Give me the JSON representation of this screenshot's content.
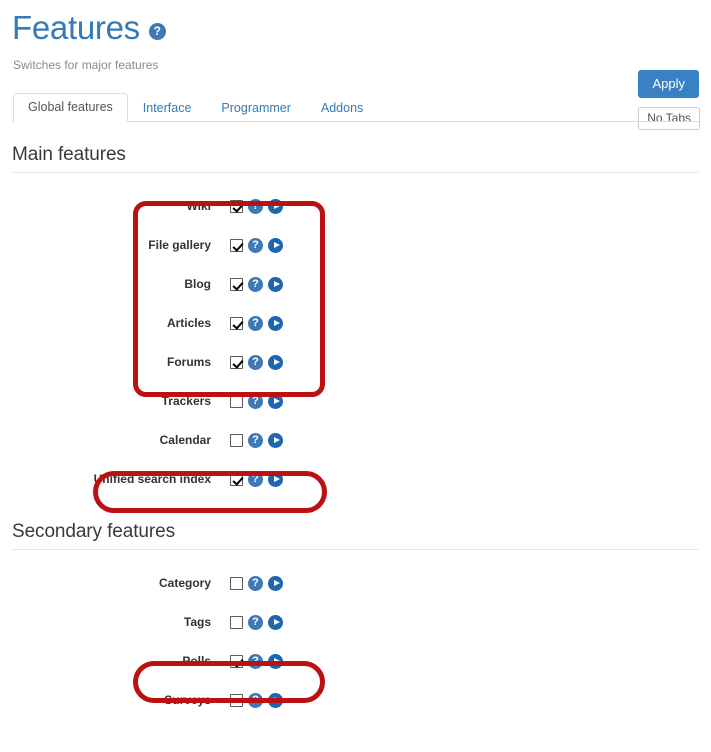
{
  "header": {
    "title": "Features",
    "help_icon": "help-circle-icon",
    "subtitle": "Switches for major features"
  },
  "toolbar": {
    "apply_label": "Apply",
    "no_tabs_label": "No Tabs"
  },
  "tabs": [
    {
      "label": "Global features",
      "active": true
    },
    {
      "label": "Interface",
      "active": false
    },
    {
      "label": "Programmer",
      "active": false
    },
    {
      "label": "Addons",
      "active": false
    }
  ],
  "sections": [
    {
      "title": "Main features",
      "features": [
        {
          "label": "Wiki",
          "checked": true,
          "help_icon": "help-circle-icon",
          "video_icon": "play-circle-icon"
        },
        {
          "label": "File gallery",
          "checked": true,
          "help_icon": "help-circle-icon",
          "video_icon": "play-circle-icon"
        },
        {
          "label": "Blog",
          "checked": true,
          "help_icon": "help-circle-icon",
          "video_icon": "play-circle-icon"
        },
        {
          "label": "Articles",
          "checked": true,
          "help_icon": "help-circle-icon",
          "video_icon": "play-circle-icon"
        },
        {
          "label": "Forums",
          "checked": true,
          "help_icon": "help-circle-icon",
          "video_icon": "play-circle-icon"
        },
        {
          "label": "Trackers",
          "checked": false,
          "help_icon": "help-circle-icon",
          "video_icon": "play-circle-icon"
        },
        {
          "label": "Calendar",
          "checked": false,
          "help_icon": "help-circle-icon",
          "video_icon": "play-circle-icon"
        },
        {
          "label": "Unified search index",
          "checked": true,
          "help_icon": "help-circle-icon",
          "video_icon": "play-circle-icon"
        }
      ]
    },
    {
      "title": "Secondary features",
      "features": [
        {
          "label": "Category",
          "checked": false,
          "help_icon": "help-circle-icon",
          "video_icon": "play-circle-icon"
        },
        {
          "label": "Tags",
          "checked": false,
          "help_icon": "help-circle-icon",
          "video_icon": "play-circle-icon"
        },
        {
          "label": "Polls",
          "checked": true,
          "help_icon": "help-circle-icon",
          "video_icon": "play-circle-icon"
        },
        {
          "label": "Surveys",
          "checked": false,
          "help_icon": "help-circle-icon",
          "video_icon": "play-circle-icon"
        }
      ]
    }
  ],
  "annotations": [
    {
      "id": "annot-main-group",
      "targets": "Wiki, File gallery, Blog, Articles, Forums",
      "color": "#bb1111"
    },
    {
      "id": "annot-unified",
      "targets": "Unified search index",
      "color": "#bb1111"
    },
    {
      "id": "annot-polls",
      "targets": "Polls",
      "color": "#bb1111"
    }
  ]
}
